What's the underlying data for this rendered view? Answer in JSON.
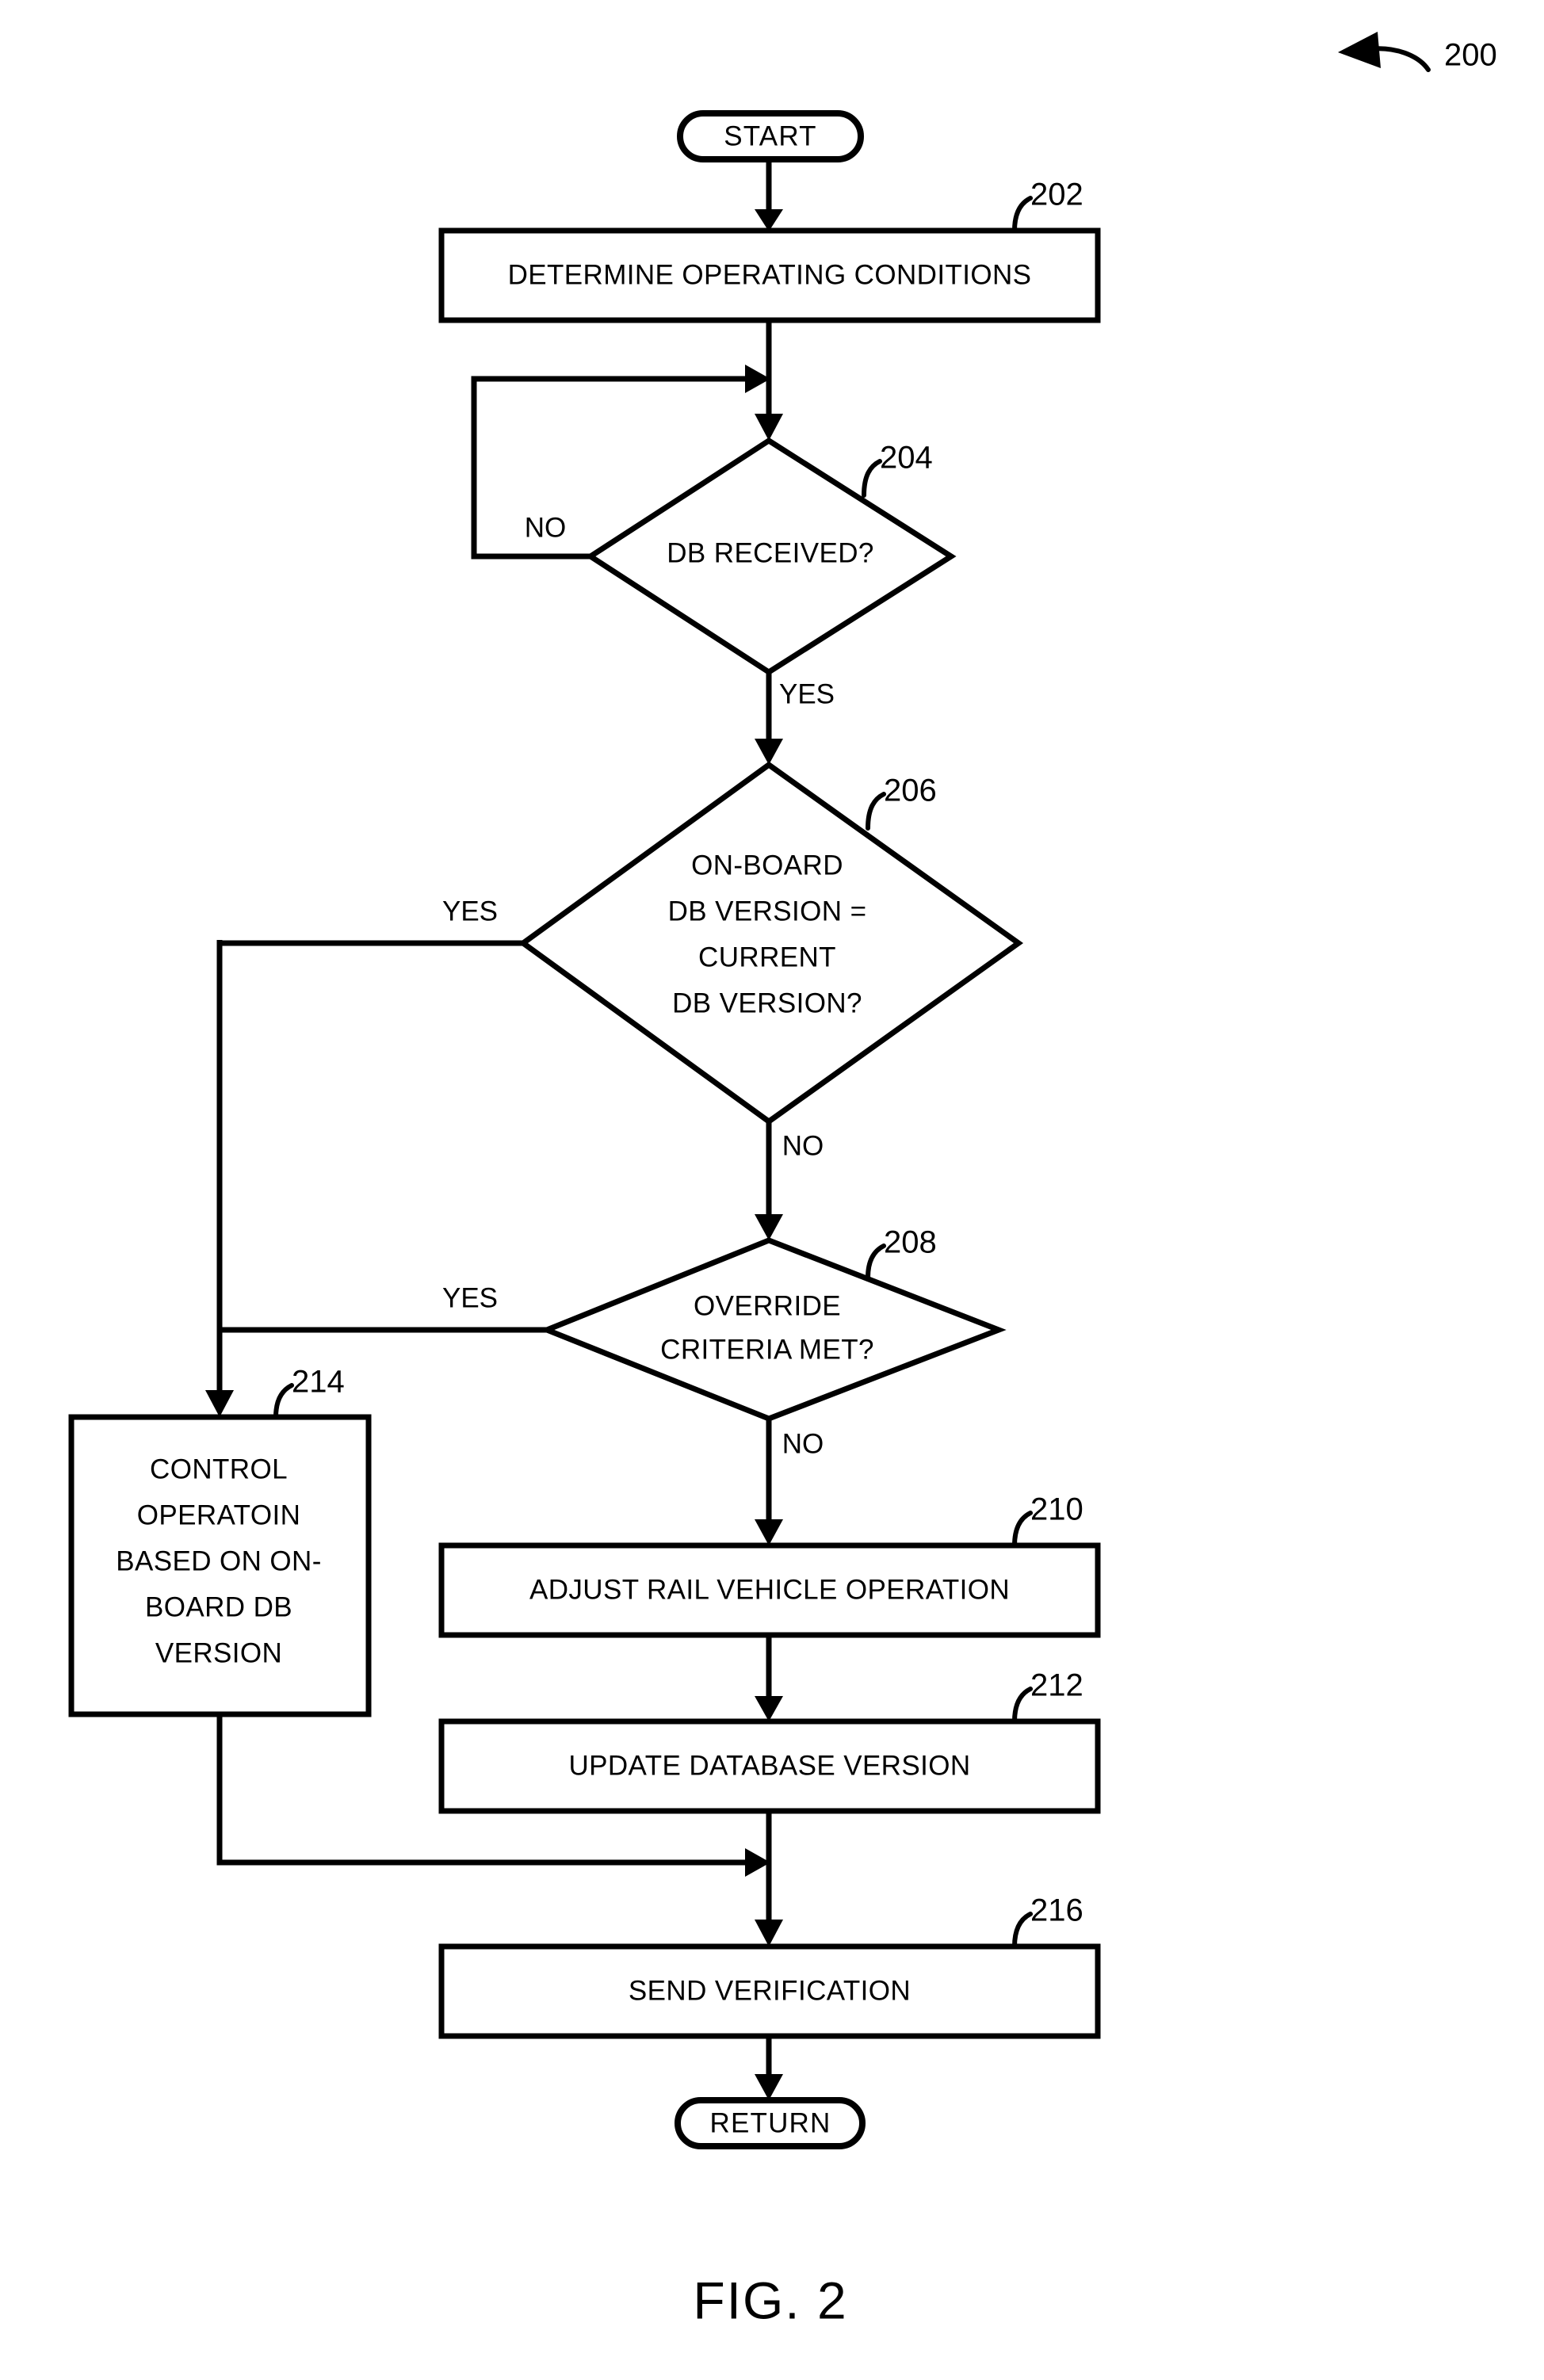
{
  "figure": {
    "caption": "FIG. 2",
    "overall_ref": "200"
  },
  "nodes": {
    "start": {
      "kind": "terminator",
      "label": "START"
    },
    "determine_conditions": {
      "kind": "process",
      "ref": "202",
      "label": "DETERMINE OPERATING CONDITIONS"
    },
    "db_received": {
      "kind": "decision",
      "ref": "204",
      "label": "DB RECEIVED?",
      "lines": [
        "DB RECEIVED?"
      ]
    },
    "version_match": {
      "kind": "decision",
      "ref": "206",
      "label": "ON-BOARD DB VERSION = CURRENT DB VERSION?",
      "lines": [
        "ON-BOARD",
        "DB VERSION =",
        "CURRENT",
        "DB VERSION?"
      ]
    },
    "override_criteria": {
      "kind": "decision",
      "ref": "208",
      "label": "OVERRIDE CRITERIA MET?",
      "lines": [
        "OVERRIDE",
        "CRITERIA MET?"
      ]
    },
    "control_operation": {
      "kind": "process",
      "ref": "214",
      "label": "CONTROL OPERATOIN BASED ON ON-BOARD DB VERSION",
      "lines": [
        "CONTROL",
        "OPERATOIN",
        "BASED ON ON-",
        "BOARD DB",
        "VERSION"
      ]
    },
    "adjust_operation": {
      "kind": "process",
      "ref": "210",
      "label": "ADJUST RAIL VEHICLE OPERATION"
    },
    "update_database": {
      "kind": "process",
      "ref": "212",
      "label": "UPDATE DATABASE VERSION"
    },
    "send_verification": {
      "kind": "process",
      "ref": "216",
      "label": "SEND VERIFICATION"
    },
    "return": {
      "kind": "terminator",
      "label": "RETURN"
    }
  },
  "branch_labels": {
    "db_received_no": "NO",
    "db_received_yes": "YES",
    "version_match_yes": "YES",
    "version_match_no": "NO",
    "override_yes": "YES",
    "override_no": "NO"
  },
  "chart_data": {
    "type": "diagram",
    "subtype": "flowchart",
    "title": "FIG. 2",
    "nodes": [
      {
        "id": "start",
        "ref": null,
        "shape": "terminator",
        "text": "START"
      },
      {
        "id": "determine_conditions",
        "ref": "202",
        "shape": "rectangle",
        "text": "DETERMINE OPERATING CONDITIONS"
      },
      {
        "id": "db_received",
        "ref": "204",
        "shape": "diamond",
        "text": "DB RECEIVED?"
      },
      {
        "id": "version_match",
        "ref": "206",
        "shape": "diamond",
        "text": "ON-BOARD DB VERSION = CURRENT DB VERSION?"
      },
      {
        "id": "override_criteria",
        "ref": "208",
        "shape": "diamond",
        "text": "OVERRIDE CRITERIA MET?"
      },
      {
        "id": "control_operation",
        "ref": "214",
        "shape": "rectangle",
        "text": "CONTROL OPERATOIN BASED ON ON-BOARD DB VERSION"
      },
      {
        "id": "adjust_operation",
        "ref": "210",
        "shape": "rectangle",
        "text": "ADJUST RAIL VEHICLE OPERATION"
      },
      {
        "id": "update_database",
        "ref": "212",
        "shape": "rectangle",
        "text": "UPDATE DATABASE VERSION"
      },
      {
        "id": "send_verification",
        "ref": "216",
        "shape": "rectangle",
        "text": "SEND VERIFICATION"
      },
      {
        "id": "return",
        "ref": null,
        "shape": "terminator",
        "text": "RETURN"
      }
    ],
    "edges": [
      {
        "from": "start",
        "to": "determine_conditions",
        "label": ""
      },
      {
        "from": "determine_conditions",
        "to": "db_received",
        "label": ""
      },
      {
        "from": "db_received",
        "to": "db_received",
        "label": "NO"
      },
      {
        "from": "db_received",
        "to": "version_match",
        "label": "YES"
      },
      {
        "from": "version_match",
        "to": "control_operation",
        "label": "YES"
      },
      {
        "from": "version_match",
        "to": "override_criteria",
        "label": "NO"
      },
      {
        "from": "override_criteria",
        "to": "control_operation",
        "label": "YES"
      },
      {
        "from": "override_criteria",
        "to": "adjust_operation",
        "label": "NO"
      },
      {
        "from": "adjust_operation",
        "to": "update_database",
        "label": ""
      },
      {
        "from": "update_database",
        "to": "send_verification",
        "label": ""
      },
      {
        "from": "control_operation",
        "to": "send_verification",
        "label": ""
      },
      {
        "from": "send_verification",
        "to": "return",
        "label": ""
      }
    ]
  }
}
